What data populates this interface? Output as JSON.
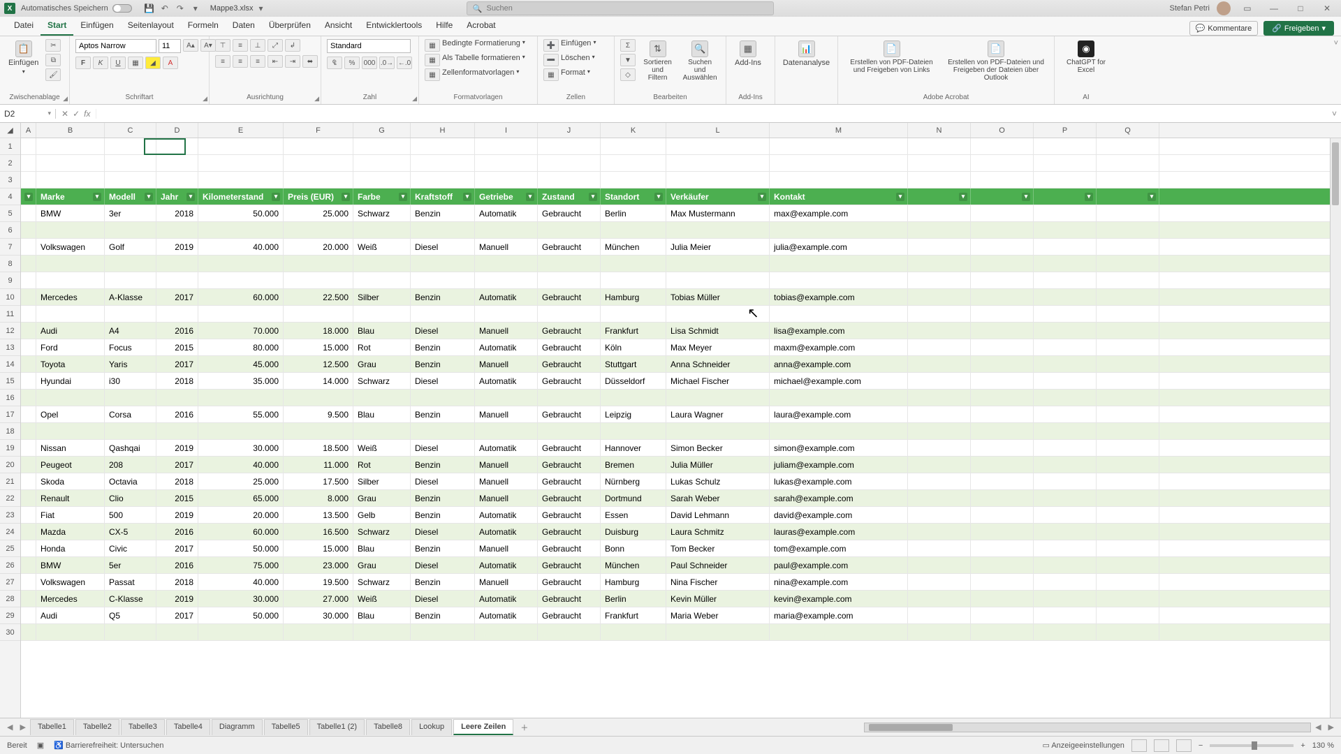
{
  "titlebar": {
    "autosave_label": "Automatisches Speichern",
    "filename": "Mappe3.xlsx",
    "search_placeholder": "Suchen",
    "username": "Stefan Petri"
  },
  "menu": {
    "tabs": [
      "Datei",
      "Start",
      "Einfügen",
      "Seitenlayout",
      "Formeln",
      "Daten",
      "Überprüfen",
      "Ansicht",
      "Entwicklertools",
      "Hilfe",
      "Acrobat"
    ],
    "active": "Start",
    "comments": "Kommentare",
    "share": "Freigeben"
  },
  "ribbon": {
    "clipboard": {
      "paste": "Einfügen",
      "label": "Zwischenablage"
    },
    "font": {
      "name": "Aptos Narrow",
      "size": "11",
      "label": "Schriftart"
    },
    "align": {
      "label": "Ausrichtung"
    },
    "number": {
      "format": "Standard",
      "label": "Zahl"
    },
    "styles": {
      "cond": "Bedingte Formatierung",
      "astable": "Als Tabelle formatieren",
      "cellfmt": "Zellenformatvorlagen",
      "label": "Formatvorlagen"
    },
    "cells": {
      "insert": "Einfügen",
      "delete": "Löschen",
      "format": "Format",
      "label": "Zellen"
    },
    "editing": {
      "sort": "Sortieren und Filtern",
      "find": "Suchen und Auswählen",
      "label": "Bearbeiten"
    },
    "addins": {
      "addin": "Add-Ins",
      "label": "Add-Ins"
    },
    "data_analysis": "Datenanalyse",
    "acrobat": {
      "a": "Erstellen von PDF-Dateien und Freigeben von Links",
      "b": "Erstellen von PDF-Dateien und Freigeben der Dateien über Outlook",
      "label": "Adobe Acrobat"
    },
    "ai": {
      "gpt": "ChatGPT for Excel",
      "label": "AI"
    }
  },
  "formula": {
    "cellref": "D2",
    "value": ""
  },
  "columns": [
    "A",
    "B",
    "C",
    "D",
    "E",
    "F",
    "G",
    "H",
    "I",
    "J",
    "K",
    "L",
    "M",
    "N",
    "O",
    "P",
    "Q"
  ],
  "rownums": [
    1,
    2,
    3,
    4,
    5,
    6,
    7,
    8,
    9,
    10,
    11,
    12,
    13,
    14,
    15,
    16,
    17,
    18,
    19,
    20,
    21,
    22,
    23,
    24,
    25,
    26,
    27,
    28,
    29,
    30
  ],
  "table": {
    "headers": [
      "Marke",
      "Modell",
      "Jahr",
      "Kilometerstand",
      "Preis (EUR)",
      "Farbe",
      "Kraftstoff",
      "Getriebe",
      "Zustand",
      "Standort",
      "Verkäufer",
      "Kontakt"
    ],
    "rows": [
      {
        "r": 5,
        "alt": false,
        "c": [
          "BMW",
          "3er",
          "2018",
          "50.000",
          "25.000",
          "Schwarz",
          "Benzin",
          "Automatik",
          "Gebraucht",
          "Berlin",
          "Max Mustermann",
          "max@example.com"
        ]
      },
      {
        "r": 6,
        "alt": true,
        "c": [
          "",
          "",
          "",
          "",
          "",
          "",
          "",
          "",
          "",
          "",
          "",
          ""
        ]
      },
      {
        "r": 7,
        "alt": false,
        "c": [
          "Volkswagen",
          "Golf",
          "2019",
          "40.000",
          "20.000",
          "Weiß",
          "Diesel",
          "Manuell",
          "Gebraucht",
          "München",
          "Julia Meier",
          "julia@example.com"
        ]
      },
      {
        "r": 8,
        "alt": true,
        "c": [
          "",
          "",
          "",
          "",
          "",
          "",
          "",
          "",
          "",
          "",
          "",
          ""
        ]
      },
      {
        "r": 9,
        "alt": false,
        "c": [
          "",
          "",
          "",
          "",
          "",
          "",
          "",
          "",
          "",
          "",
          "",
          ""
        ]
      },
      {
        "r": 10,
        "alt": true,
        "c": [
          "Mercedes",
          "A-Klasse",
          "2017",
          "60.000",
          "22.500",
          "Silber",
          "Benzin",
          "Automatik",
          "Gebraucht",
          "Hamburg",
          "Tobias Müller",
          "tobias@example.com"
        ]
      },
      {
        "r": 11,
        "alt": false,
        "c": [
          "",
          "",
          "",
          "",
          "",
          "",
          "",
          "",
          "",
          "",
          "",
          ""
        ]
      },
      {
        "r": 12,
        "alt": true,
        "c": [
          "Audi",
          "A4",
          "2016",
          "70.000",
          "18.000",
          "Blau",
          "Diesel",
          "Manuell",
          "Gebraucht",
          "Frankfurt",
          "Lisa Schmidt",
          "lisa@example.com"
        ]
      },
      {
        "r": 13,
        "alt": false,
        "c": [
          "Ford",
          "Focus",
          "2015",
          "80.000",
          "15.000",
          "Rot",
          "Benzin",
          "Automatik",
          "Gebraucht",
          "Köln",
          "Max Meyer",
          "maxm@example.com"
        ]
      },
      {
        "r": 14,
        "alt": true,
        "c": [
          "Toyota",
          "Yaris",
          "2017",
          "45.000",
          "12.500",
          "Grau",
          "Benzin",
          "Manuell",
          "Gebraucht",
          "Stuttgart",
          "Anna Schneider",
          "anna@example.com"
        ]
      },
      {
        "r": 15,
        "alt": false,
        "c": [
          "Hyundai",
          "i30",
          "2018",
          "35.000",
          "14.000",
          "Schwarz",
          "Diesel",
          "Automatik",
          "Gebraucht",
          "Düsseldorf",
          "Michael Fischer",
          "michael@example.com"
        ]
      },
      {
        "r": 16,
        "alt": true,
        "c": [
          "",
          "",
          "",
          "",
          "",
          "",
          "",
          "",
          "",
          "",
          "",
          ""
        ]
      },
      {
        "r": 17,
        "alt": false,
        "c": [
          "Opel",
          "Corsa",
          "2016",
          "55.000",
          "9.500",
          "Blau",
          "Benzin",
          "Manuell",
          "Gebraucht",
          "Leipzig",
          "Laura Wagner",
          "laura@example.com"
        ]
      },
      {
        "r": 18,
        "alt": true,
        "c": [
          "",
          "",
          "",
          "",
          "",
          "",
          "",
          "",
          "",
          "",
          "",
          ""
        ]
      },
      {
        "r": 19,
        "alt": false,
        "c": [
          "Nissan",
          "Qashqai",
          "2019",
          "30.000",
          "18.500",
          "Weiß",
          "Diesel",
          "Automatik",
          "Gebraucht",
          "Hannover",
          "Simon Becker",
          "simon@example.com"
        ]
      },
      {
        "r": 20,
        "alt": true,
        "c": [
          "Peugeot",
          "208",
          "2017",
          "40.000",
          "11.000",
          "Rot",
          "Benzin",
          "Manuell",
          "Gebraucht",
          "Bremen",
          "Julia Müller",
          "juliam@example.com"
        ]
      },
      {
        "r": 21,
        "alt": false,
        "c": [
          "Skoda",
          "Octavia",
          "2018",
          "25.000",
          "17.500",
          "Silber",
          "Diesel",
          "Manuell",
          "Gebraucht",
          "Nürnberg",
          "Lukas Schulz",
          "lukas@example.com"
        ]
      },
      {
        "r": 22,
        "alt": true,
        "c": [
          "Renault",
          "Clio",
          "2015",
          "65.000",
          "8.000",
          "Grau",
          "Benzin",
          "Manuell",
          "Gebraucht",
          "Dortmund",
          "Sarah Weber",
          "sarah@example.com"
        ]
      },
      {
        "r": 23,
        "alt": false,
        "c": [
          "Fiat",
          "500",
          "2019",
          "20.000",
          "13.500",
          "Gelb",
          "Benzin",
          "Automatik",
          "Gebraucht",
          "Essen",
          "David Lehmann",
          "david@example.com"
        ]
      },
      {
        "r": 24,
        "alt": true,
        "c": [
          "Mazda",
          "CX-5",
          "2016",
          "60.000",
          "16.500",
          "Schwarz",
          "Diesel",
          "Automatik",
          "Gebraucht",
          "Duisburg",
          "Laura Schmitz",
          "lauras@example.com"
        ]
      },
      {
        "r": 25,
        "alt": false,
        "c": [
          "Honda",
          "Civic",
          "2017",
          "50.000",
          "15.000",
          "Blau",
          "Benzin",
          "Manuell",
          "Gebraucht",
          "Bonn",
          "Tom Becker",
          "tom@example.com"
        ]
      },
      {
        "r": 26,
        "alt": true,
        "c": [
          "BMW",
          "5er",
          "2016",
          "75.000",
          "23.000",
          "Grau",
          "Diesel",
          "Automatik",
          "Gebraucht",
          "München",
          "Paul Schneider",
          "paul@example.com"
        ]
      },
      {
        "r": 27,
        "alt": false,
        "c": [
          "Volkswagen",
          "Passat",
          "2018",
          "40.000",
          "19.500",
          "Schwarz",
          "Benzin",
          "Manuell",
          "Gebraucht",
          "Hamburg",
          "Nina Fischer",
          "nina@example.com"
        ]
      },
      {
        "r": 28,
        "alt": true,
        "c": [
          "Mercedes",
          "C-Klasse",
          "2019",
          "30.000",
          "27.000",
          "Weiß",
          "Diesel",
          "Automatik",
          "Gebraucht",
          "Berlin",
          "Kevin Müller",
          "kevin@example.com"
        ]
      },
      {
        "r": 29,
        "alt": false,
        "c": [
          "Audi",
          "Q5",
          "2017",
          "50.000",
          "30.000",
          "Blau",
          "Benzin",
          "Automatik",
          "Gebraucht",
          "Frankfurt",
          "Maria Weber",
          "maria@example.com"
        ]
      }
    ]
  },
  "sheets": {
    "tabs": [
      "Tabelle1",
      "Tabelle2",
      "Tabelle3",
      "Tabelle4",
      "Diagramm",
      "Tabelle5",
      "Tabelle1 (2)",
      "Tabelle8",
      "Lookup",
      "Leere Zeilen"
    ],
    "active": "Leere Zeilen"
  },
  "status": {
    "ready": "Bereit",
    "accessibility": "Barrierefreiheit: Untersuchen",
    "display": "Anzeigeeinstellungen",
    "zoom": "130 %"
  }
}
